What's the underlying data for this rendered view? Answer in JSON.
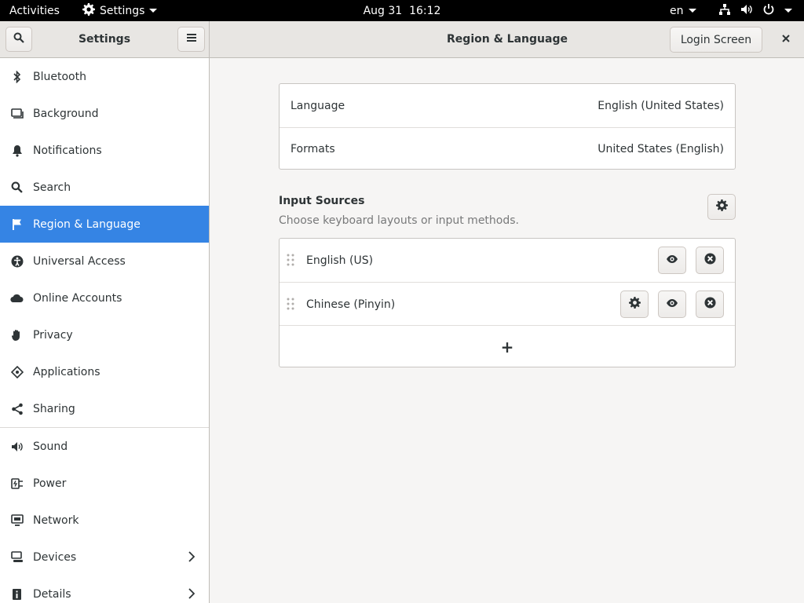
{
  "topbar": {
    "activities": "Activities",
    "app_name": "Settings",
    "date": "Aug 31",
    "time": "16:12",
    "input_lang": "en"
  },
  "headerbar": {
    "sidebar_title": "Settings",
    "page_title": "Region & Language",
    "login_screen_label": "Login Screen"
  },
  "sidebar": {
    "items": [
      {
        "label": "Bluetooth",
        "icon": "bluetooth-icon"
      },
      {
        "label": "Background",
        "icon": "background-icon"
      },
      {
        "label": "Notifications",
        "icon": "bell-icon"
      },
      {
        "label": "Search",
        "icon": "search-icon"
      },
      {
        "label": "Region & Language",
        "icon": "flag-icon",
        "active": true
      },
      {
        "label": "Universal Access",
        "icon": "accessibility-icon"
      },
      {
        "label": "Online Accounts",
        "icon": "cloud-icon"
      },
      {
        "label": "Privacy",
        "icon": "hand-icon"
      },
      {
        "label": "Applications",
        "icon": "applications-icon"
      },
      {
        "label": "Sharing",
        "icon": "share-icon"
      },
      {
        "label": "Sound",
        "icon": "speaker-icon"
      },
      {
        "label": "Power",
        "icon": "power-plug-icon"
      },
      {
        "label": "Network",
        "icon": "network-icon"
      },
      {
        "label": "Devices",
        "icon": "devices-icon"
      },
      {
        "label": "Details",
        "icon": "info-icon"
      }
    ]
  },
  "region": {
    "language_label": "Language",
    "language_value": "English (United States)",
    "formats_label": "Formats",
    "formats_value": "United States (English)"
  },
  "input_sources": {
    "title": "Input Sources",
    "subtitle": "Choose keyboard layouts or input methods.",
    "sources": [
      {
        "label": "English (US)"
      },
      {
        "label": "Chinese (Pinyin)"
      }
    ],
    "add_label": "+"
  },
  "colors": {
    "accent": "#3584e4",
    "topbar_bg": "#000000",
    "headerbar_bg": "#e8e6e3"
  }
}
